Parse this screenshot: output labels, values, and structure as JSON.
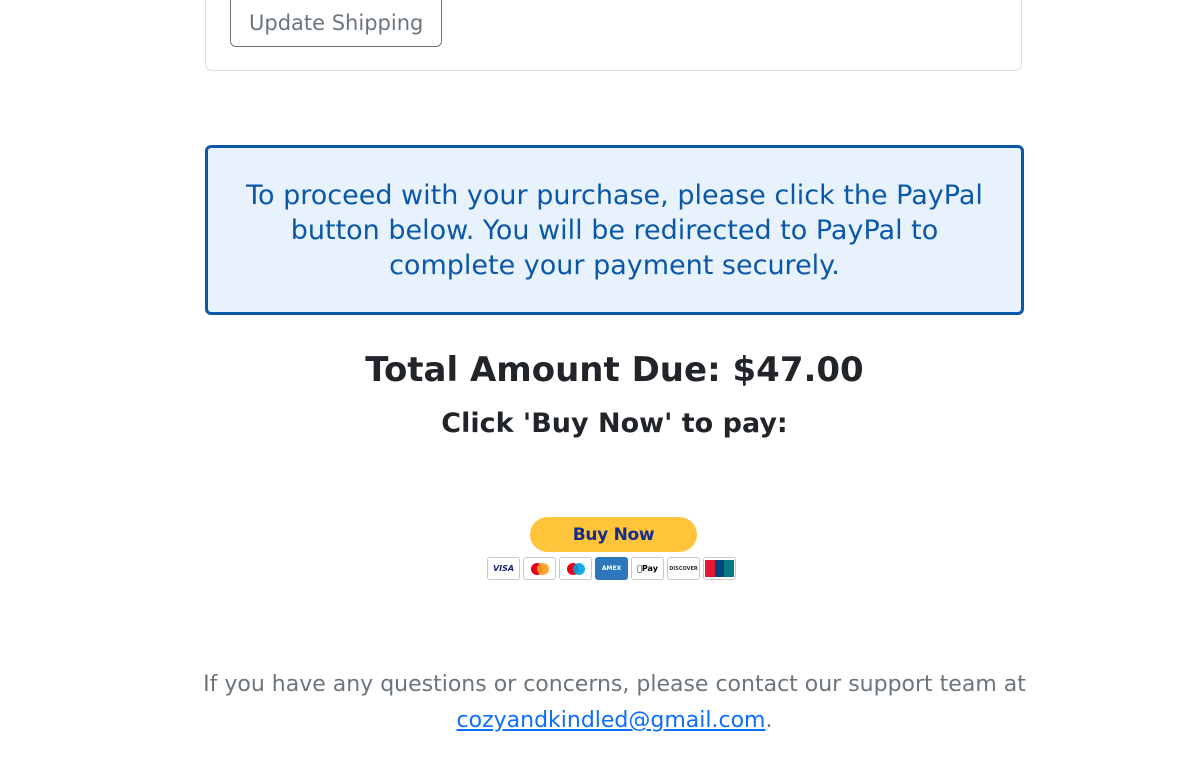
{
  "shipping": {
    "update_button_label": "Update Shipping"
  },
  "info_alert": {
    "text": "To proceed with your purchase, please click the PayPal button below. You will be redirected to PayPal to complete your payment securely."
  },
  "total": {
    "label": "Total Amount Due: ",
    "amount": "$47.00"
  },
  "instruction": "Click 'Buy Now' to pay:",
  "paypal": {
    "button_label": "Buy Now",
    "card_icons": [
      "visa-icon",
      "mastercard-icon",
      "maestro-icon",
      "amex-icon",
      "apple-pay-icon",
      "discover-icon",
      "unionpay-icon"
    ],
    "card_text": {
      "visa": "VISA",
      "amex": "AMEX",
      "apple_pay": "Pay",
      "discover": "DISCOVER"
    }
  },
  "footer": {
    "text": "If you have any questions or concerns, please contact our support team at",
    "email": "cozyandkindled@gmail.com",
    "period": "."
  },
  "colors": {
    "info_border": "#0b57a8",
    "info_bg": "#e7f2fd",
    "paypal_yellow": "#ffc439",
    "paypal_navy": "#142c8e",
    "link": "#0d6efd",
    "muted": "#6c757d"
  }
}
